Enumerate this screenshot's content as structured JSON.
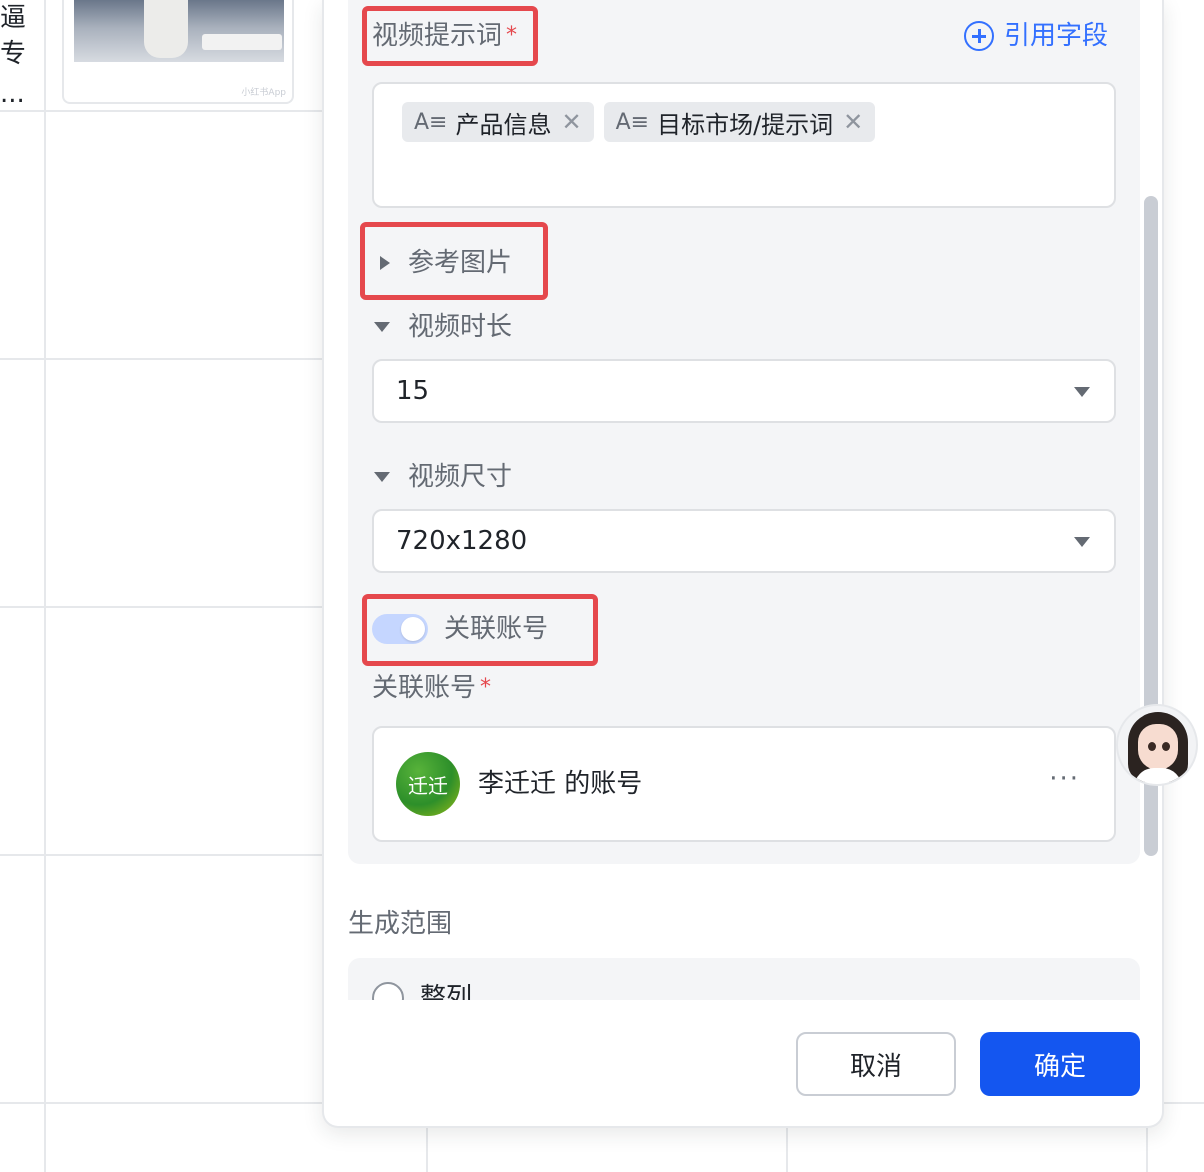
{
  "background": {
    "cut_text": [
      "逼",
      "专",
      "..."
    ],
    "thumbnail_mark": "小红书App"
  },
  "panel": {
    "prompt_label": "视频提示词",
    "required_mark": "*",
    "cite_field_label": "引用字段",
    "tags": [
      {
        "label": "产品信息"
      },
      {
        "label": "目标市场/提示词"
      }
    ],
    "reference_image_label": "参考图片",
    "duration_label": "视频时长",
    "duration_value": "15",
    "size_label": "视频尺寸",
    "size_value": "720x1280",
    "link_account_toggle_label": "关联账号",
    "link_account_label": "关联账号",
    "account": {
      "avatar_text": "迁迁",
      "name": "李迁迁 的账号",
      "more": "···"
    },
    "range_label": "生成范围",
    "range_option": "整列",
    "cancel_label": "取消",
    "confirm_label": "确定"
  },
  "colors": {
    "accent": "#3370ff",
    "primary_button": "#1456f0",
    "highlight": "#e5484d",
    "toggle_on": "#c5d6ff"
  }
}
